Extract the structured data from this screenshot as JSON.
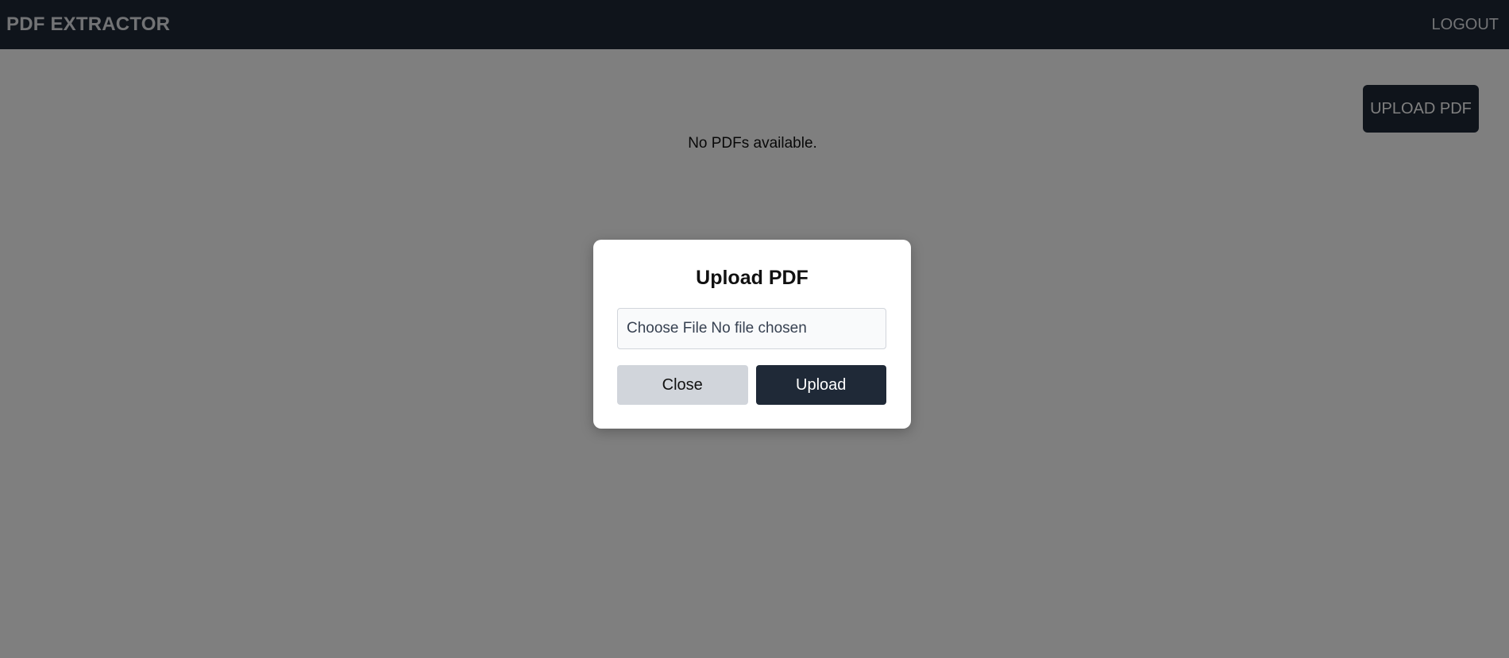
{
  "navbar": {
    "brand": "PDF EXTRACTOR",
    "logout_label": "LOGOUT"
  },
  "main": {
    "upload_button_label": "UPLOAD PDF",
    "empty_message": "No PDFs available."
  },
  "modal": {
    "title": "Upload PDF",
    "file_input": {
      "button_label": "Choose File",
      "status": "No file chosen"
    },
    "close_label": "Close",
    "upload_label": "Upload"
  },
  "colors": {
    "navbar_bg": "#1f2937",
    "primary_button": "#1f2937",
    "secondary_button": "#d1d5db",
    "overlay": "rgba(0,0,0,0.5)"
  }
}
